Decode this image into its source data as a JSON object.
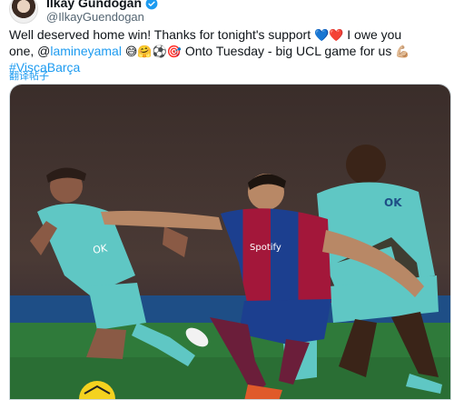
{
  "author": {
    "display_name": "Ilkay Gündogan",
    "handle": "@IlkayGuendogan",
    "verified": true
  },
  "tweet": {
    "line1": "Well deserved home win! Thanks for tonight's support",
    "line1_emojis": "💙❤️",
    "line1_tail": "I owe you",
    "line2_a": "one, @",
    "mention": "lamineyamal",
    "line2_emojis": "😅🤗⚽🎯",
    "line2_tail": "Onto Tuesday - big UCL game for us",
    "line2_end_emoji": "💪🏼",
    "hashtag": "#ViscaBarça",
    "translate_label": "翻译帖子"
  },
  "media": {
    "jersey_sponsor": "Spotify",
    "opponent_sponsor": "OK",
    "colors": {
      "barca_blue": "#1c3f8f",
      "barca_red": "#a3173a",
      "opponent_kit": "#5fc7c4",
      "pitch": "#2f7a3a"
    }
  }
}
